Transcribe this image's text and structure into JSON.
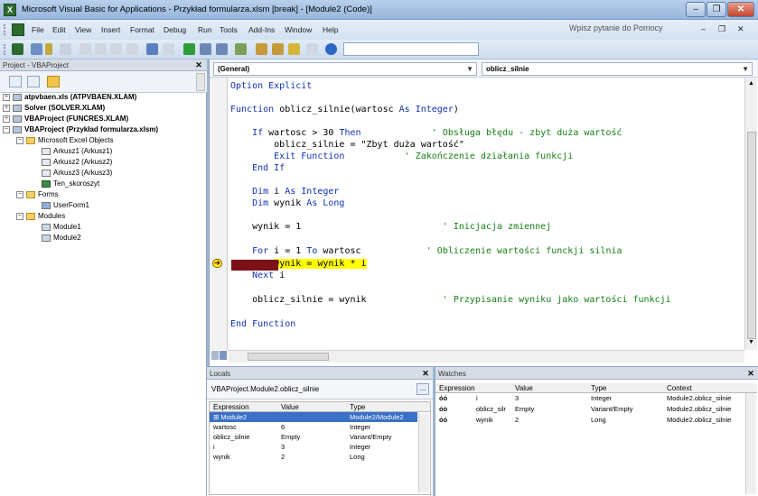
{
  "window": {
    "title": "Microsoft Visual Basic for Applications - Przykład formularza.xlsm [break] - [Module2 (Code)]",
    "minimize": "–",
    "restore": "❐",
    "close": "✕"
  },
  "menu": {
    "items": [
      "File",
      "Edit",
      "View",
      "Insert",
      "Format",
      "Debug",
      "Run",
      "Tools",
      "Add-Ins",
      "Window",
      "Help"
    ],
    "help_placeholder": "Wpisz pytanie do Pomocy",
    "mdi_min": "–",
    "mdi_restore": "❐",
    "mdi_close": "✕"
  },
  "project": {
    "title": "Project - VBAProject",
    "close": "✕",
    "nodes": [
      {
        "label": "atpvbaen.xls (ATPVBAEN.XLAM)",
        "bold": true
      },
      {
        "label": "Solver (SOLVER.XLAM)",
        "bold": true
      },
      {
        "label": "VBAProject (FUNCRES.XLAM)",
        "bold": true
      },
      {
        "label": "VBAProject (Przykład formularza.xlsm)",
        "bold": true
      },
      {
        "label": "Microsoft Excel Objects",
        "bold": false
      },
      {
        "label": "Arkusz1 (Arkusz1)",
        "bold": false
      },
      {
        "label": "Arkusz2 (Arkusz2)",
        "bold": false
      },
      {
        "label": "Arkusz3 (Arkusz3)",
        "bold": false
      },
      {
        "label": "Ten_skoroszyt",
        "bold": false
      },
      {
        "label": "Forms",
        "bold": false
      },
      {
        "label": "UserForm1",
        "bold": false
      },
      {
        "label": "Modules",
        "bold": false
      },
      {
        "label": "Module1",
        "bold": false
      },
      {
        "label": "Module2",
        "bold": false
      }
    ]
  },
  "code": {
    "object_combo": "(General)",
    "proc_combo": "oblicz_silnie",
    "lines": [
      {
        "parts": [
          {
            "t": "Option Explicit",
            "c": "kw"
          }
        ]
      },
      {
        "parts": [
          {
            "t": "Function ",
            "c": "kw"
          },
          {
            "t": "oblicz_silnie(wartosc ",
            "c": ""
          },
          {
            "t": "As Integer",
            "c": "kw"
          },
          {
            "t": ")",
            "c": ""
          }
        ]
      },
      {
        "parts": [
          {
            "t": "    If ",
            "c": "kw"
          },
          {
            "t": "wartosc > 30 ",
            "c": ""
          },
          {
            "t": "Then",
            "c": "kw"
          },
          {
            "t": "             ' Obsługa błędu - zbyt duża wartość",
            "c": "cm"
          }
        ]
      },
      {
        "parts": [
          {
            "t": "        oblicz_silnie = \"Zbyt duża wartość\"",
            "c": ""
          }
        ]
      },
      {
        "parts": [
          {
            "t": "        Exit Function",
            "c": "kw"
          },
          {
            "t": "           ' Zakończenie działania funkcji",
            "c": "cm"
          }
        ]
      },
      {
        "parts": [
          {
            "t": "    End If",
            "c": "kw"
          }
        ]
      },
      {
        "parts": [
          {
            "t": "    Dim ",
            "c": "kw"
          },
          {
            "t": "i ",
            "c": ""
          },
          {
            "t": "As Integer",
            "c": "kw"
          }
        ]
      },
      {
        "parts": [
          {
            "t": "    Dim ",
            "c": "kw"
          },
          {
            "t": "wynik ",
            "c": ""
          },
          {
            "t": "As Long",
            "c": "kw"
          }
        ]
      },
      {
        "parts": [
          {
            "t": "    wynik = 1",
            "c": ""
          },
          {
            "t": "                          ' Inicjacja zmiennej",
            "c": "cm"
          }
        ]
      },
      {
        "parts": [
          {
            "t": "    For ",
            "c": "kw"
          },
          {
            "t": "i = 1 ",
            "c": ""
          },
          {
            "t": "To ",
            "c": "kw"
          },
          {
            "t": "wartosc",
            "c": ""
          },
          {
            "t": "            ' Obliczenie wartości funckji silnia",
            "c": "cm"
          }
        ]
      },
      {
        "parts": [
          {
            "t": "        ",
            "c": ""
          },
          {
            "t": "wynik = wynik * i",
            "c": "hl"
          }
        ]
      },
      {
        "parts": [
          {
            "t": "    Next ",
            "c": "kw"
          },
          {
            "t": "i",
            "c": ""
          }
        ]
      },
      {
        "parts": [
          {
            "t": "    oblicz_silnie = wynik",
            "c": ""
          },
          {
            "t": "              ' Przypisanie wyniku jako wartości funkcji",
            "c": "cm"
          }
        ]
      },
      {
        "parts": [
          {
            "t": "End Function",
            "c": "kw"
          }
        ]
      }
    ]
  },
  "locals": {
    "title": "Locals",
    "close": "✕",
    "context": "VBAProject.Module2.oblicz_silnie",
    "context_btn": "...",
    "headers": [
      "Expression",
      "Value",
      "Type"
    ],
    "rows": [
      {
        "expression": "⊞ Module2",
        "value": "",
        "type": "Module2/Module2"
      },
      {
        "expression": "wartosc",
        "value": "6",
        "type": "Integer"
      },
      {
        "expression": "oblicz_silnie",
        "value": "Empty",
        "type": "Variant/Empty"
      },
      {
        "expression": "i",
        "value": "3",
        "type": "Integer"
      },
      {
        "expression": "wynik",
        "value": "2",
        "type": "Long"
      }
    ]
  },
  "watches": {
    "title": "Watches",
    "close": "✕",
    "headers": [
      "Expression",
      "Value",
      "Type",
      "Context"
    ],
    "rows": [
      {
        "icon": "όό",
        "expression": "i",
        "value": "3",
        "type": "Integer",
        "context": "Module2.oblicz_silnie"
      },
      {
        "icon": "όό",
        "expression": "oblicz_silr",
        "value": "Empty",
        "type": "Variant/Empty",
        "context": "Module2.oblicz_silnie"
      },
      {
        "icon": "όό",
        "expression": "wynik",
        "value": "2",
        "type": "Long",
        "context": "Module2.oblicz_silnie"
      }
    ]
  },
  "colors": {
    "keyword": "#1032b4",
    "comment": "#168016",
    "highlight": "#ffff00",
    "breakpoint": "#7e1018"
  }
}
